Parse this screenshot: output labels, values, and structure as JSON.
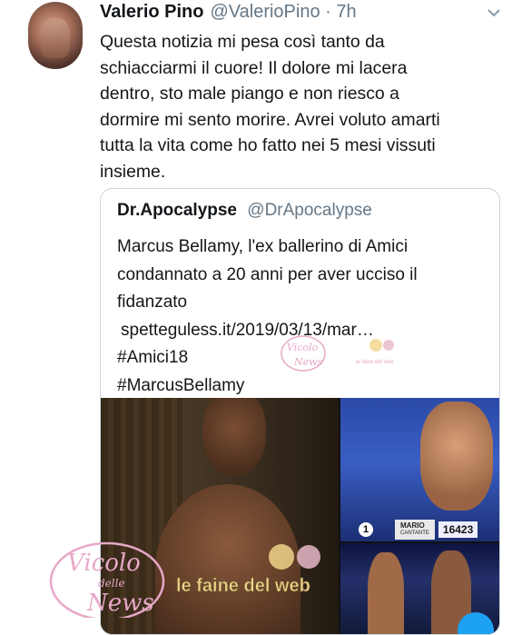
{
  "tweet": {
    "author_name": "Valerio Pino",
    "author_handle": "@ValerioPino",
    "separator": " · ",
    "time": "7h",
    "lines": [
      "Questa notizia mi pesa così tanto da",
      "schiacciarmi il cuore! Il dolore mi lacera",
      "dentro, sto male piango e non riesco a",
      "dormire mi sento morire. Avrei voluto amarti",
      "tutta la vita come ho fatto nei 5 mesi vissuti",
      "insieme."
    ]
  },
  "quoted": {
    "author_name": "Dr.Apocalypse",
    "author_handle": "@DrApocalypse",
    "lines": [
      "Marcus Bellamy, l'ex ballerino di Amici",
      "condannato a 20 anni per aver ucciso il",
      "fidanzato",
      "spetteguless.it/2019/03/13/mar…",
      "#Amici18",
      "#MarcusBellamy"
    ],
    "scoreboard": {
      "position": "1",
      "contestant_name": "MARIO",
      "contestant_role": "CANTANTE",
      "score": "16423"
    }
  },
  "watermark": {
    "logo_text_1": "Vicolo",
    "logo_text_2": "delle",
    "logo_text_3": "News",
    "caption": "le faine del web"
  },
  "icons": [
    "chevron-down-icon"
  ],
  "colors": {
    "secondary_text": "#657786",
    "border": "#ccd6dd",
    "watermark": "#e7a8c8"
  }
}
